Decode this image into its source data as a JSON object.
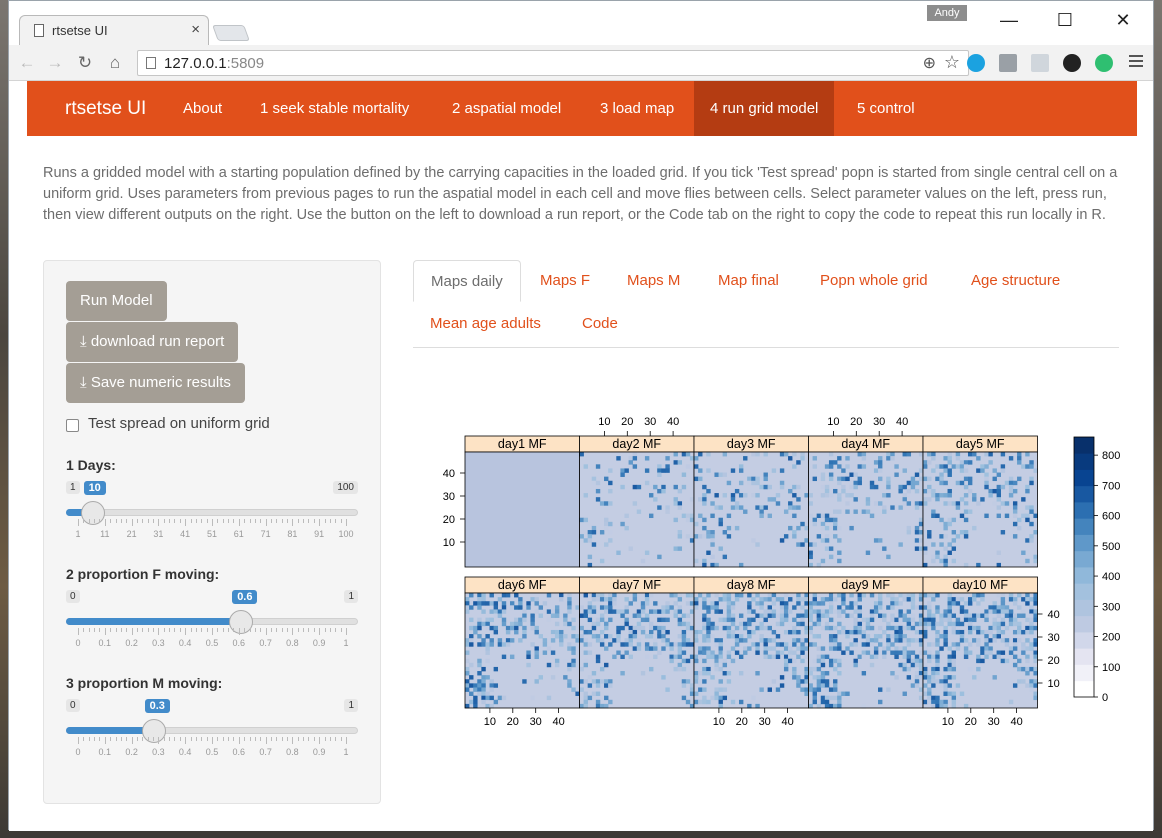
{
  "browser": {
    "tab_title": "rtsetse UI",
    "tab_close": "×",
    "user_name": "Andy",
    "url_host": "127.0.0.1",
    "url_port": ":5809"
  },
  "app": {
    "brand": "rtsetse UI",
    "nav": [
      {
        "label": "About"
      },
      {
        "label": "1 seek stable mortality"
      },
      {
        "label": "2 aspatial model"
      },
      {
        "label": "3 load map"
      },
      {
        "label": "4 run grid model"
      },
      {
        "label": "5 control"
      }
    ],
    "description": "Runs a gridded model with a starting population defined by the carrying capacities in the loaded grid. If you tick 'Test spread' popn is started from single central cell on a uniform grid. Uses parameters from previous pages to run the aspatial model in each cell and move flies between cells. Select parameter values on the left, press run, then view different outputs on the right. Use the button on the left to download a run report, or the Code tab on the right to copy the code to repeat this run locally in R."
  },
  "sidebar": {
    "run_label": "Run Model",
    "download_label": "download run report",
    "save_label": "Save numeric results",
    "checkbox_label": "Test spread on uniform grid",
    "checkbox_checked": false,
    "sliders": [
      {
        "label": "1 Days:",
        "min": "1",
        "max": "100",
        "value": "10",
        "fraction": 0.091,
        "ticks": [
          "1",
          "11",
          "21",
          "31",
          "41",
          "51",
          "61",
          "71",
          "81",
          "91",
          "100"
        ]
      },
      {
        "label": "2 proportion F moving:",
        "min": "0",
        "max": "1",
        "value": "0.6",
        "fraction": 0.6,
        "ticks": [
          "0",
          "0.1",
          "0.2",
          "0.3",
          "0.4",
          "0.5",
          "0.6",
          "0.7",
          "0.8",
          "0.9",
          "1"
        ]
      },
      {
        "label": "3 proportion M moving:",
        "min": "0",
        "max": "1",
        "value": "0.3",
        "fraction": 0.3,
        "ticks": [
          "0",
          "0.1",
          "0.2",
          "0.3",
          "0.4",
          "0.5",
          "0.6",
          "0.7",
          "0.8",
          "0.9",
          "1"
        ]
      }
    ]
  },
  "tabs": [
    {
      "label": "Maps daily",
      "active": true
    },
    {
      "label": "Maps F"
    },
    {
      "label": "Maps M"
    },
    {
      "label": "Map final"
    },
    {
      "label": "Popn whole grid"
    },
    {
      "label": "Age structure"
    },
    {
      "label": "Mean age adults"
    },
    {
      "label": "Code"
    }
  ],
  "plot": {
    "panels": [
      "day1 MF",
      "day2 MF",
      "day3 MF",
      "day4 MF",
      "day5 MF",
      "day6 MF",
      "day7 MF",
      "day8 MF",
      "day9 MF",
      "day10 MF"
    ],
    "axis_ticks": [
      "10",
      "20",
      "30",
      "40"
    ],
    "colorbar_ticks": [
      "0",
      "100",
      "200",
      "300",
      "400",
      "500",
      "600",
      "700",
      "800"
    ],
    "colorbar_max": 860,
    "colors": {
      "strip": "#fde3c5",
      "low": "#ffffff",
      "high": "#08306b"
    }
  }
}
